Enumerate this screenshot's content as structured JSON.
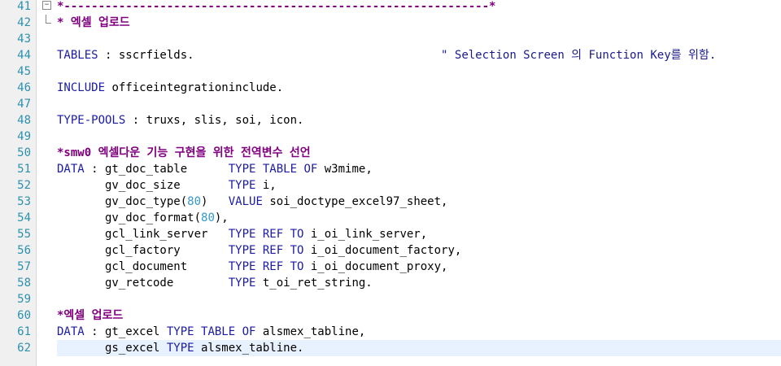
{
  "editor": {
    "lines": [
      {
        "n": "41",
        "segs": [
          [
            "cm",
            "*--------------------------------------------------------------*"
          ]
        ]
      },
      {
        "n": "42",
        "segs": [
          [
            "cm",
            "* 엑셀 업로드"
          ]
        ]
      },
      {
        "n": "43",
        "segs": []
      },
      {
        "n": "44",
        "segs": [
          [
            "kw",
            "TABLES"
          ],
          [
            "id",
            " : sscrfields."
          ],
          [
            "id",
            "                                    "
          ],
          [
            "str",
            "\" Selection Screen 의 Function Key를 위함."
          ]
        ]
      },
      {
        "n": "45",
        "segs": []
      },
      {
        "n": "46",
        "segs": [
          [
            "kw",
            "INCLUDE"
          ],
          [
            "id",
            " officeintegrationinclude."
          ]
        ]
      },
      {
        "n": "47",
        "segs": []
      },
      {
        "n": "48",
        "segs": [
          [
            "kw",
            "TYPE-POOLS"
          ],
          [
            "id",
            " : truxs, slis, soi, icon."
          ]
        ]
      },
      {
        "n": "49",
        "segs": []
      },
      {
        "n": "50",
        "segs": [
          [
            "cm",
            "*smw0 엑셀다운 기능 구현을 위한 전역변수 선언"
          ]
        ]
      },
      {
        "n": "51",
        "segs": [
          [
            "kw",
            "DATA"
          ],
          [
            "id",
            " : gt_doc_table      "
          ],
          [
            "kw",
            "TYPE TABLE OF"
          ],
          [
            "id",
            " w3mime,"
          ]
        ]
      },
      {
        "n": "52",
        "segs": [
          [
            "id",
            "       gv_doc_size       "
          ],
          [
            "kw",
            "TYPE"
          ],
          [
            "id",
            " i,"
          ]
        ]
      },
      {
        "n": "53",
        "segs": [
          [
            "id",
            "       gv_doc_type("
          ],
          [
            "numlit",
            "80"
          ],
          [
            "id",
            ")   "
          ],
          [
            "kw",
            "VALUE"
          ],
          [
            "id",
            " soi_doctype_excel97_sheet,"
          ]
        ]
      },
      {
        "n": "54",
        "segs": [
          [
            "id",
            "       gv_doc_format("
          ],
          [
            "numlit",
            "80"
          ],
          [
            "id",
            "),"
          ]
        ]
      },
      {
        "n": "55",
        "segs": [
          [
            "id",
            "       gcl_link_server   "
          ],
          [
            "kw",
            "TYPE REF TO"
          ],
          [
            "id",
            " i_oi_link_server,"
          ]
        ]
      },
      {
        "n": "56",
        "segs": [
          [
            "id",
            "       gcl_factory       "
          ],
          [
            "kw",
            "TYPE REF TO"
          ],
          [
            "id",
            " i_oi_document_factory,"
          ]
        ]
      },
      {
        "n": "57",
        "segs": [
          [
            "id",
            "       gcl_document      "
          ],
          [
            "kw",
            "TYPE REF TO"
          ],
          [
            "id",
            " i_oi_document_proxy,"
          ]
        ]
      },
      {
        "n": "58",
        "segs": [
          [
            "id",
            "       gv_retcode        "
          ],
          [
            "kw",
            "TYPE"
          ],
          [
            "id",
            " t_oi_ret_string."
          ]
        ]
      },
      {
        "n": "59",
        "segs": []
      },
      {
        "n": "60",
        "segs": [
          [
            "cm",
            "*엑셀 업로드"
          ]
        ]
      },
      {
        "n": "61",
        "segs": [
          [
            "kw",
            "DATA"
          ],
          [
            "id",
            " : gt_excel "
          ],
          [
            "kw",
            "TYPE TABLE OF"
          ],
          [
            "id",
            " alsmex_tabline,"
          ]
        ]
      },
      {
        "n": "62",
        "segs": [
          [
            "id",
            "       gs_excel "
          ],
          [
            "kw",
            "TYPE"
          ],
          [
            "id",
            " alsmex_tabline."
          ]
        ],
        "current": true
      }
    ]
  }
}
